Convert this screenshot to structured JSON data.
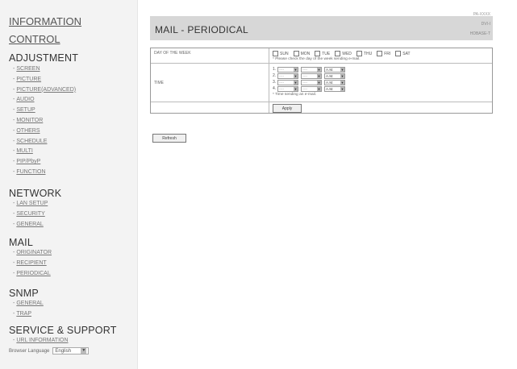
{
  "sidebar": {
    "information": "INFORMATION",
    "control": "CONTROL",
    "adjustment": {
      "title": "ADJUSTMENT",
      "items": [
        "SCREEN",
        "PICTURE",
        "PICTURE(ADVANCED)",
        "AUDIO",
        "SETUP",
        "MONITOR",
        "OTHERS",
        "SCHEDULE",
        "MULTI",
        "PIP/PbyP",
        "FUNCTION"
      ]
    },
    "network": {
      "title": "NETWORK",
      "items": [
        "LAN SETUP",
        "SECURITY",
        "GENERAL"
      ]
    },
    "mail": {
      "title": "MAIL",
      "items": [
        "ORIGINATOR",
        "RECIPIENT",
        "PERIODICAL"
      ]
    },
    "snmp": {
      "title": "SNMP",
      "items": [
        "GENERAL",
        "TRAP"
      ]
    },
    "service": {
      "title": "SERVICE & SUPPORT",
      "items": [
        "URL INFORMATION"
      ]
    },
    "browser_language_label": "Browser Language",
    "browser_language_value": "English"
  },
  "header": {
    "title": "MAIL - PERIODICAL",
    "model": "PA-XXXX",
    "series_a": "DVI-I",
    "series_b": "HDBASE-T"
  },
  "form": {
    "day_label": "DAY OF THE WEEK",
    "days": [
      "SUN",
      "MON",
      "TUE",
      "WED",
      "THU",
      "FRI",
      "SAT"
    ],
    "day_note": "* Please check the day of the week sending e-mail.",
    "time_label": "TIME",
    "time_rows": [
      {
        "num": "1.",
        "hour": "----",
        "minute": "----",
        "ampm": "A.M."
      },
      {
        "num": "2.",
        "hour": "----",
        "minute": "----",
        "ampm": "A.M."
      },
      {
        "num": "3.",
        "hour": "----",
        "minute": "----",
        "ampm": "A.M."
      },
      {
        "num": "4.",
        "hour": "----",
        "minute": "----",
        "ampm": "A.M."
      }
    ],
    "time_note": "* Time sending an e-mail.",
    "apply_label": "Apply",
    "refresh_label": "Refresh"
  },
  "colors": {
    "header_bg": "#d7d7d7",
    "sidebar_bg": "#f3f3f3"
  }
}
